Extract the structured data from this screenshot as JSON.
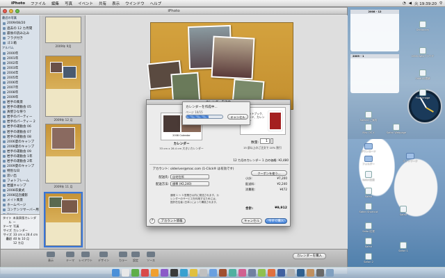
{
  "menubar": {
    "app": "iPhoto",
    "items": [
      "ファイル",
      "編集",
      "写真",
      "イベント",
      "共有",
      "表示",
      "ウインドウ",
      "ヘルプ"
    ],
    "clock": "火 19:39:20"
  },
  "window": {
    "title": "iPhoto"
  },
  "source": {
    "items": [
      {
        "label": "最近の写真",
        "header": true
      },
      {
        "label": "2009/08/20"
      },
      {
        "label": "過去の 12 カ月間"
      },
      {
        "label": "最後の読み込み"
      },
      {
        "label": "フラグ付き"
      },
      {
        "label": "ゴミ箱"
      },
      {
        "label": "アルバム",
        "header": true
      },
      {
        "label": "2000年"
      },
      {
        "label": "2001年"
      },
      {
        "label": "2002年"
      },
      {
        "label": "2003年"
      },
      {
        "label": "2004年"
      },
      {
        "label": "2005年"
      },
      {
        "label": "2006年"
      },
      {
        "label": "2007年"
      },
      {
        "label": "2008年"
      },
      {
        "label": "2009年"
      },
      {
        "label": "岩手の風景"
      },
      {
        "label": "岩手の運動会 05"
      },
      {
        "label": "真壁ひな祭り"
      },
      {
        "label": "岩手のパーティー"
      },
      {
        "label": "岩手のパーティー 2"
      },
      {
        "label": "岩手の運動会 06"
      },
      {
        "label": "岩手の運動会 07"
      },
      {
        "label": "岩手の運動会 08"
      },
      {
        "label": "2006夏のキャンプ"
      },
      {
        "label": "2008夏のキャンプ"
      },
      {
        "label": "岩手の運動会 09"
      },
      {
        "label": "岩手の運動会 1年"
      },
      {
        "label": "岩手の運動会 2年"
      },
      {
        "label": "2009夏のキャンプ"
      },
      {
        "label": "特別な日"
      },
      {
        "label": "思い出"
      },
      {
        "label": "フォトフレーム"
      },
      {
        "label": "岩國キャンプ"
      },
      {
        "label": "2008卒業式"
      },
      {
        "label": "2008記念撮影"
      },
      {
        "label": "メイト風景"
      },
      {
        "label": "ホームページ"
      },
      {
        "label": "コンテンツサーバー用"
      },
      {
        "label": "Happy"
      },
      {
        "label": "晴れ日和の運動会"
      },
      {
        "label": "2009年秋"
      },
      {
        "label": "マイプロジェクト",
        "header": true
      },
      {
        "label": "未発表版カレンダー"
      },
      {
        "label": "未発表版カレンダー"
      }
    ],
    "selected_index": 45
  },
  "info": {
    "rows": [
      {
        "k": "タイトル",
        "v": "未発表版カレンダー"
      },
      {
        "k": "テーマ",
        "v": "写真"
      },
      {
        "k": "サイズ",
        "v": "カレンダー"
      },
      {
        "k": "サイズ",
        "v": "33 cm x 28.4 cm"
      },
      {
        "k": "最初",
        "v": "40 年 10 月"
      },
      {
        "k": "",
        "v": "12 カ月"
      }
    ]
  },
  "pages": {
    "labels": [
      "2009年 9月",
      "2009年 12 月",
      "2009年 11 月",
      "2010年 11 月"
    ]
  },
  "toolbar": {
    "buttons": [
      "表示",
      "テーマ",
      "レイアウト",
      "デザイン",
      "カラー",
      "設定",
      "ソース"
    ],
    "make_calendar": "カレンダーを購入",
    "status": "49 枚の写真"
  },
  "sheet": {
    "title": "カレンダーを注文",
    "product_name": "カレンダー",
    "product_desc": "33 cm x 28.4 cm 大きいカレンダー",
    "product_year": "2008 Calendar",
    "book_card": "フォトブック、カード、カレンダー",
    "qty_label": "数量:",
    "qty": "1",
    "qty_note": "15 部以上のご注文で 10% 割引",
    "summary": "12 カ月のカレンダー 1 点の価格:  ¥2,480",
    "account_label": "アカウント:",
    "account_value": "olderiver@mac.com (1-Click® は有効です)",
    "ship_to_label": "配送先:",
    "ship_to": "自宅住所",
    "ship_method_label": "配送方法:",
    "ship_method": "標準 (¥2,240)",
    "coupon": "クーポンを使う...",
    "rows": [
      {
        "k": "小計:",
        "v": "¥7,200"
      },
      {
        "k": "配送料:",
        "v": "¥2,240"
      },
      {
        "k": "消費税:",
        "v": "¥472"
      }
    ],
    "ship_note": "通常 1 ～ 3 営業日以内に発送されます。カレンダーのサービスを利用するためには、国外在住者 (日本) によって構成されます。",
    "total_label": "合計:",
    "total": "¥9,912",
    "account_info": "アカウント情報",
    "cancel": "キャンセル",
    "buy": "今すぐ購入"
  },
  "progress": {
    "title": "カレンダーを作成中...",
    "page": "ページ 10/15",
    "cancel": "キャンセル",
    "fraction": 0.62
  },
  "desktop": {
    "calendar_month": "2008 - 12",
    "calendar2_month": "2009 - 1",
    "icons": [
      "Dictionary",
      "DMM Webブラウザ",
      "Safariの更新",
      "Pixel Image",
      "Safariのご案内",
      "Mac OS X",
      "Safari Webpage",
      "ダウンロード",
      "フォルダー",
      "ネットワーク",
      "Safari文書",
      "Safari",
      "Safari Shortcut",
      "Safari",
      "Safari文書",
      "Safari",
      "Safari 1",
      "Safari 2"
    ]
  }
}
